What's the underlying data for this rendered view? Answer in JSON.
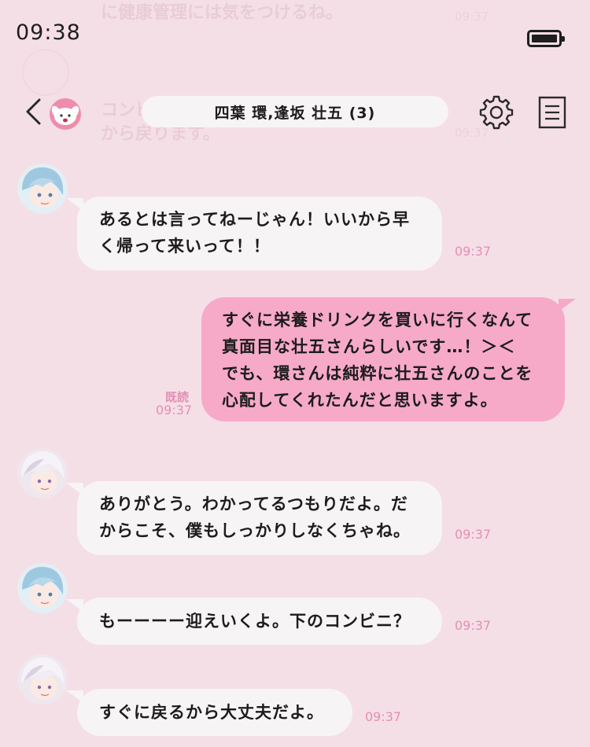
{
  "status_bar": {
    "time": "09:38"
  },
  "background_messages": [
    {
      "text": "に健康管理には気をつけるね。",
      "time": "09:37"
    },
    {
      "text_line1": "コンビ",
      "text_line2": "から戻ります。",
      "time": "09:37"
    }
  ],
  "header": {
    "title": "四葉 環,逢坂 壮五 (3)",
    "back_icon": "chevron-left-icon",
    "logo_icon": "rabbit-mascot-icon",
    "settings_icon": "gear-icon",
    "menu_icon": "notes-icon"
  },
  "messages": [
    {
      "direction": "incoming",
      "avatar": "light-blue-hair-avatar",
      "text": "あるとは言ってねーじゃん！いいから早\nく帰って来いって！！",
      "time": "09:37"
    },
    {
      "direction": "outgoing",
      "text": "すぐに栄養ドリンクを買いに行くなんて\n真面目な壮五さんらしいです…！＞＜\nでも、環さんは純粋に壮五さんのことを\n心配してくれたんだと思いますよ。",
      "read_label": "既読",
      "time": "09:37"
    },
    {
      "direction": "incoming",
      "avatar": "white-hair-avatar",
      "text": "ありがとう。わかってるつもりだよ。だ\nからこそ、僕もしっかりしなくちゃね。",
      "time": "09:37"
    },
    {
      "direction": "incoming",
      "avatar": "light-blue-hair-avatar",
      "text": "もーーーー迎えいくよ。下のコンビニ？",
      "time": "09:37"
    },
    {
      "direction": "incoming",
      "avatar": "white-hair-avatar",
      "text": "すぐに戻るから大丈夫だよ。",
      "time": "09:37"
    }
  ],
  "colors": {
    "background": "#f5dfe6",
    "incoming_bubble": "#f7f4f5",
    "outgoing_bubble": "#f6aac8",
    "timestamp": "#e48eb6"
  }
}
